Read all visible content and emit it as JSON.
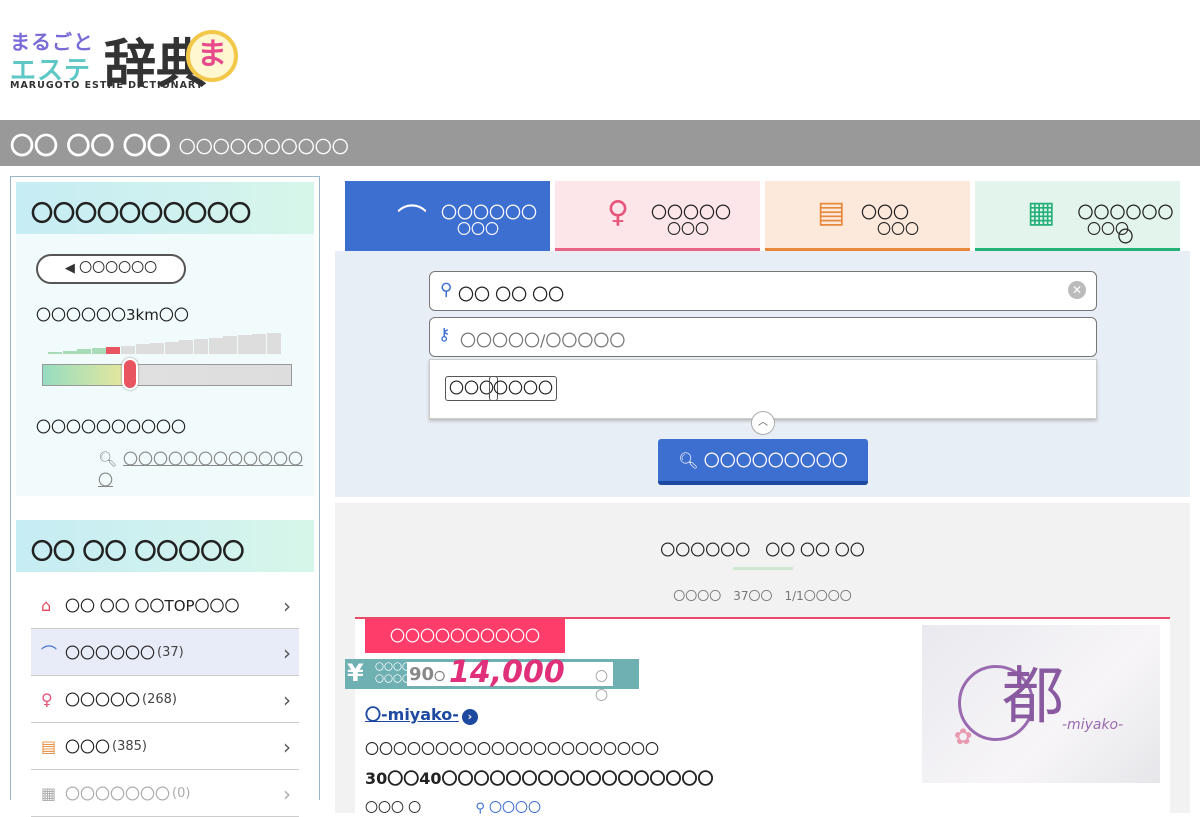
{
  "logo": {
    "line1": "まるごと",
    "line2": "エステ",
    "big": "辞典",
    "mascot": "ま",
    "sub": "MARUGOTO ESTHE DICTIONARY"
  },
  "titlebar": {
    "title": "〇〇 〇〇 〇〇",
    "subtitle": "〇〇〇〇〇〇〇〇〇〇"
  },
  "sidebar": {
    "section1_title": "〇〇〇〇〇〇〇〇〇〇",
    "back_button": "〇〇〇〇〇〇",
    "radius_label": "〇〇〇〇〇〇3km〇〇",
    "slider_fraction": 0.3,
    "condition_label": "〇〇〇〇〇〇〇〇〇〇",
    "condition_link": "〇〇〇〇〇〇〇〇〇〇〇〇〇",
    "section2_title": "〇〇 〇〇 〇〇〇〇〇",
    "nav": [
      {
        "icon": "home-icon",
        "label": "〇〇 〇〇 〇〇TOP〇〇〇",
        "count": ""
      },
      {
        "icon": "hanger-icon",
        "label": "〇〇〇〇〇〇",
        "count": "(37)"
      },
      {
        "icon": "woman-icon",
        "label": "〇〇〇〇〇",
        "count": "(268)"
      },
      {
        "icon": "chat-icon",
        "label": "〇〇〇",
        "count": "(385)"
      },
      {
        "icon": "calendar-icon",
        "label": "〇〇〇〇〇〇〇",
        "count": "(0)"
      }
    ]
  },
  "tabs": [
    {
      "line1": "〇〇〇〇〇〇",
      "line2": "〇〇〇"
    },
    {
      "line1": "〇〇〇〇〇",
      "line2": "〇〇〇"
    },
    {
      "line1": "〇〇〇",
      "line2": "〇〇〇"
    },
    {
      "line1": "〇〇〇〇〇〇〇",
      "line2": "〇〇〇"
    }
  ],
  "search": {
    "location_value": "〇〇 〇〇 〇〇",
    "keyword_placeholder": "〇〇〇〇〇/〇〇〇〇〇",
    "chips": [
      "〇〇〇",
      "〇〇〇〇"
    ],
    "button": "〇〇〇〇〇〇〇〇〇"
  },
  "results": {
    "title": "〇〇〇〇〇〇　〇〇 〇〇 〇〇",
    "meta": "〇〇〇〇　37〇〇　1/1〇〇〇〇"
  },
  "card": {
    "badge": "〇〇〇〇〇〇〇〇〇〇",
    "price_label1": "〇〇〇〇",
    "price_label2": "〇〇〇〇",
    "minutes": "90",
    "minutes_unit": "〇",
    "amount": "14,000",
    "amount_unit": "〇〇",
    "shop_name": "〇-miyako-",
    "catch": "〇〇〇〇〇〇〇〇〇〇〇〇〇〇〇〇〇〇〇〇〇",
    "desc": "30〇〇40〇〇〇〇〇〇〇〇〇〇〇〇〇〇〇〇〇",
    "loc_prefix": "〇〇〇",
    "loc_suffix": "〇",
    "loc_link": "〇〇〇〇",
    "image_kanji": "都",
    "image_sub": "-miyako-"
  },
  "colors": {
    "accent_blue": "#3d6fd1",
    "pink": "#ff3d6a",
    "titlebar": "#999999"
  }
}
